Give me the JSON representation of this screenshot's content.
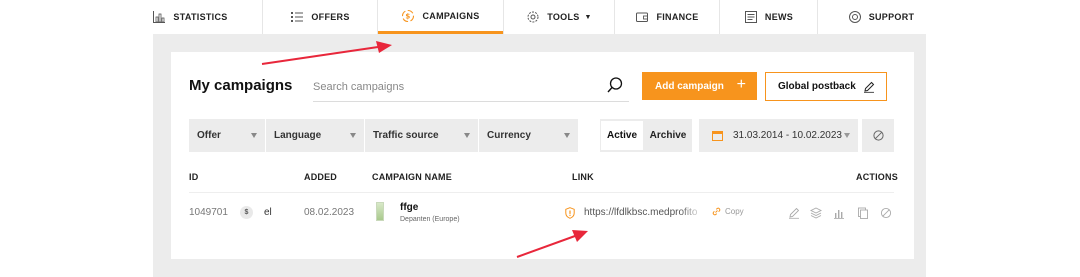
{
  "nav": {
    "items": [
      {
        "label": "STATISTICS",
        "icon": "bar-chart-icon"
      },
      {
        "label": "OFFERS",
        "icon": "list-icon"
      },
      {
        "label": "CAMPAIGNS",
        "icon": "campaigns-icon",
        "active": true
      },
      {
        "label": "TOOLS",
        "icon": "gear-icon"
      },
      {
        "label": "FINANCE",
        "icon": "wallet-icon"
      },
      {
        "label": "NEWS",
        "icon": "newspaper-icon"
      },
      {
        "label": "SUPPORT",
        "icon": "support-icon"
      }
    ],
    "tools_caret": "▼"
  },
  "page": {
    "title": "My campaigns",
    "search_placeholder": "Search campaigns",
    "add_button": "Add campaign",
    "add_plus": "+",
    "postback_button": "Global postback"
  },
  "filters": {
    "offer": "Offer",
    "language": "Language",
    "traffic_source": "Traffic source",
    "currency": "Currency",
    "status_active": "Active",
    "status_archive": "Archive",
    "date_range": "31.03.2014 - 10.02.2023"
  },
  "table": {
    "headers": {
      "id": "ID",
      "added": "ADDED",
      "campaign_name": "CAMPAIGN NAME",
      "link": "LINK",
      "actions": "ACTIONS"
    },
    "rows": [
      {
        "id": "1049701",
        "currency_badge": "$",
        "language": "el",
        "added": "08.02.2023",
        "name": "ffge",
        "offer_name": "Depanten (Europe)",
        "link": "https://lfdlkbsc.medprofito",
        "copy_label": "Copy"
      }
    ]
  },
  "colors": {
    "accent": "#f7941d",
    "annotation_arrow": "#e8273b",
    "panel_bg": "#ececec"
  }
}
